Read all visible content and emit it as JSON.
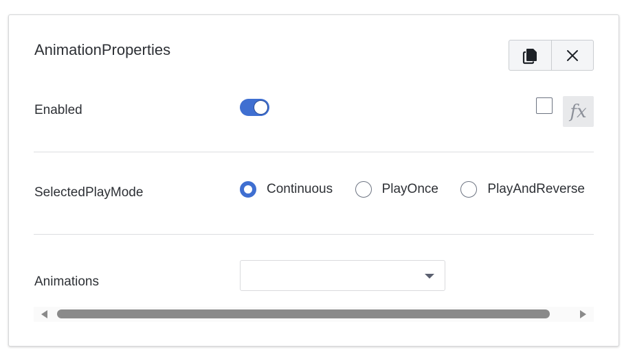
{
  "panel": {
    "title": "AnimationProperties",
    "actions": [
      {
        "name": "copy",
        "icon": "copy-icon"
      },
      {
        "name": "close",
        "icon": "close-icon"
      }
    ]
  },
  "rows": {
    "enabled": {
      "label": "Enabled",
      "toggle_on": true,
      "expression_checkbox_checked": false,
      "fx_label": "fx"
    },
    "play_mode": {
      "label": "SelectedPlayMode",
      "options": [
        "Continuous",
        "PlayOnce",
        "PlayAndReverse"
      ],
      "selected": "Continuous"
    },
    "animations": {
      "label": "Animations",
      "selected_value": ""
    }
  },
  "colors": {
    "accent": "#3f6fd1",
    "text": "#2d3035",
    "scrollbar": "#8a8a8a"
  }
}
